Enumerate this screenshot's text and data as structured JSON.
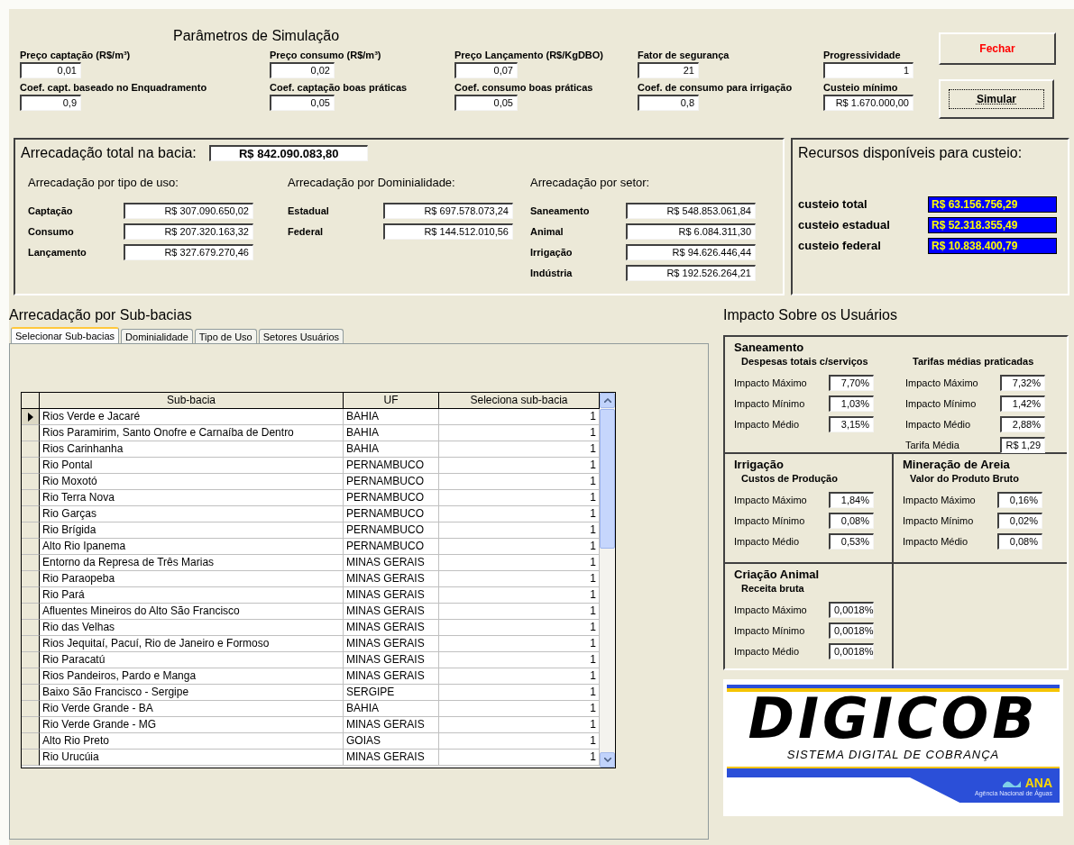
{
  "parameters": {
    "title": "Parâmetros de Simulação",
    "fields": [
      {
        "label": "Preço captação (R$/m³)",
        "value": "0,01"
      },
      {
        "label": "Preço consumo (R$/m³)",
        "value": "0,02"
      },
      {
        "label": "Preço Lançamento (R$/KgDBO)",
        "value": "0,07"
      },
      {
        "label": "Fator de segurança",
        "value": "21"
      },
      {
        "label": "Progressividade",
        "value": "1"
      },
      {
        "label": "Coef. capt. baseado no Enquadramento",
        "value": "0,9"
      },
      {
        "label": "Coef. captação boas práticas",
        "value": "0,05"
      },
      {
        "label": "Coef. consumo boas práticas",
        "value": "0,05"
      },
      {
        "label": "Coef. de consumo para irrigação",
        "value": "0,8"
      },
      {
        "label": "Custeio mínimo",
        "value": "R$ 1.670.000,00"
      }
    ]
  },
  "buttons": [
    {
      "label": "Fechar",
      "kind": "danger",
      "focused": false
    },
    {
      "label": "Simular",
      "kind": "normal",
      "focused": true
    }
  ],
  "summary": {
    "label": "Arrecadação total na bacia:",
    "value": "R$ 842.090.083,80",
    "groups": [
      {
        "title": "Arrecadação por tipo de uso:",
        "rows": [
          {
            "label": "Captação",
            "value": "R$ 307.090.650,02"
          },
          {
            "label": "Consumo",
            "value": "R$ 207.320.163,32"
          },
          {
            "label": "Lançamento",
            "value": "R$ 327.679.270,46"
          }
        ]
      },
      {
        "title": "Arrecadação por Dominialidade:",
        "rows": [
          {
            "label": "Estadual",
            "value": "R$ 697.578.073,24"
          },
          {
            "label": "Federal",
            "value": "R$ 144.512.010,56"
          }
        ]
      },
      {
        "title": "Arrecadação por setor:",
        "rows": [
          {
            "label": "Saneamento",
            "value": "R$ 548.853.061,84"
          },
          {
            "label": "Animal",
            "value": "R$ 6.084.311,30"
          },
          {
            "label": "Irrigação",
            "value": "R$ 94.626.446,44"
          },
          {
            "label": "Indústria",
            "value": "R$ 192.526.264,21"
          }
        ]
      }
    ]
  },
  "resources": {
    "title": "Recursos disponíveis para custeio:",
    "rows": [
      {
        "label": "custeio total",
        "value": "R$ 63.156.756,29"
      },
      {
        "label": "custeio estadual",
        "value": "R$ 52.318.355,49"
      },
      {
        "label": "custeio federal",
        "value": "R$ 10.838.400,79"
      }
    ]
  },
  "subbasins": {
    "title": "Arrecadação por Sub-bacias",
    "tabs": [
      {
        "label": "Selecionar Sub-bacias",
        "selected": true
      },
      {
        "label": "Dominialidade",
        "selected": false
      },
      {
        "label": "Tipo de Uso",
        "selected": false
      },
      {
        "label": "Setores Usuários",
        "selected": false
      }
    ],
    "columns": [
      "Sub-bacia",
      "UF",
      "Seleciona sub-bacia"
    ],
    "rows": [
      {
        "name": "Rios Verde e Jacaré",
        "uf": "BAHIA",
        "select": "1",
        "selected": true
      },
      {
        "name": "Rios Paramirim, Santo Onofre e Carnaíba de Dentro",
        "uf": "BAHIA",
        "select": "1",
        "selected": false
      },
      {
        "name": "Rios Carinhanha",
        "uf": "BAHIA",
        "select": "1",
        "selected": false
      },
      {
        "name": "Rio Pontal",
        "uf": "PERNAMBUCO",
        "select": "1",
        "selected": false
      },
      {
        "name": "Rio Moxotó",
        "uf": "PERNAMBUCO",
        "select": "1",
        "selected": false
      },
      {
        "name": "Rio Terra Nova",
        "uf": "PERNAMBUCO",
        "select": "1",
        "selected": false
      },
      {
        "name": "Rio Garças",
        "uf": "PERNAMBUCO",
        "select": "1",
        "selected": false
      },
      {
        "name": "Rio Brígida",
        "uf": "PERNAMBUCO",
        "select": "1",
        "selected": false
      },
      {
        "name": "Alto Rio Ipanema",
        "uf": "PERNAMBUCO",
        "select": "1",
        "selected": false
      },
      {
        "name": "Entorno da Represa de Três Marias",
        "uf": "MINAS GERAIS",
        "select": "1",
        "selected": false
      },
      {
        "name": "Rio Paraopeba",
        "uf": "MINAS GERAIS",
        "select": "1",
        "selected": false
      },
      {
        "name": "Rio Pará",
        "uf": "MINAS GERAIS",
        "select": "1",
        "selected": false
      },
      {
        "name": "Afluentes Mineiros do Alto São Francisco",
        "uf": "MINAS GERAIS",
        "select": "1",
        "selected": false
      },
      {
        "name": "Rio das Velhas",
        "uf": "MINAS GERAIS",
        "select": "1",
        "selected": false
      },
      {
        "name": "Rios Jequitaí, Pacuí, Rio de Janeiro e Formoso",
        "uf": "MINAS GERAIS",
        "select": "1",
        "selected": false
      },
      {
        "name": "Rio Paracatú",
        "uf": "MINAS GERAIS",
        "select": "1",
        "selected": false
      },
      {
        "name": "Rios Pandeiros, Pardo e Manga",
        "uf": "MINAS GERAIS",
        "select": "1",
        "selected": false
      },
      {
        "name": "Baixo São Francisco - Sergipe",
        "uf": "SERGIPE",
        "select": "1",
        "selected": false
      },
      {
        "name": "Rio Verde Grande - BA",
        "uf": "BAHIA",
        "select": "1",
        "selected": false
      },
      {
        "name": "Rio Verde Grande - MG",
        "uf": "MINAS GERAIS",
        "select": "1",
        "selected": false
      },
      {
        "name": "Alto Rio Preto",
        "uf": "GOIAS",
        "select": "1",
        "selected": false
      },
      {
        "name": "Rio Urucúia",
        "uf": "MINAS GERAIS",
        "select": "1",
        "selected": false
      }
    ]
  },
  "impact": {
    "title": "Impacto Sobre os Usuários",
    "sections": [
      {
        "title": "Saneamento",
        "groups": [
          {
            "title": "Despesas totais c/serviços",
            "rows": [
              {
                "label": "Impacto Máximo",
                "value": "7,70%"
              },
              {
                "label": "Impacto Mínimo",
                "value": "1,03%"
              },
              {
                "label": "Impacto Médio",
                "value": "3,15%"
              }
            ]
          },
          {
            "title": "Tarifas médias praticadas",
            "rows": [
              {
                "label": "Impacto Máximo",
                "value": "7,32%"
              },
              {
                "label": "Impacto Mínimo",
                "value": "1,42%"
              },
              {
                "label": "Impacto Médio",
                "value": "2,88%"
              },
              {
                "label": "Tarifa Média",
                "value": "R$ 1,29"
              }
            ]
          }
        ]
      },
      {
        "title": "Irrigação",
        "groups": [
          {
            "title": "Custos de Produção",
            "rows": [
              {
                "label": "Impacto Máximo",
                "value": "1,84%"
              },
              {
                "label": "Impacto Mínimo",
                "value": "0,08%"
              },
              {
                "label": "Impacto Médio",
                "value": "0,53%"
              }
            ]
          }
        ]
      },
      {
        "title": "Mineração de Areia",
        "groups": [
          {
            "title": "Valor do Produto Bruto",
            "rows": [
              {
                "label": "Impacto Máximo",
                "value": "0,16%"
              },
              {
                "label": "Impacto Mínimo",
                "value": "0,02%"
              },
              {
                "label": "Impacto Médio",
                "value": "0,08%"
              }
            ]
          }
        ]
      },
      {
        "title": "Criação Animal",
        "groups": [
          {
            "title": "Receita bruta",
            "rows": [
              {
                "label": "Impacto Máximo",
                "value": "0,0018%"
              },
              {
                "label": "Impacto Mínimo",
                "value": "0,0018%"
              },
              {
                "label": "Impacto Médio",
                "value": "0,0018%"
              }
            ]
          }
        ]
      }
    ]
  },
  "logo": {
    "name": "DIGICOB",
    "subtitle": "SISTEMA DIGITAL DE COBRANÇA",
    "agency": "ANA",
    "agency_name": "Agência Nacional de Águas"
  }
}
